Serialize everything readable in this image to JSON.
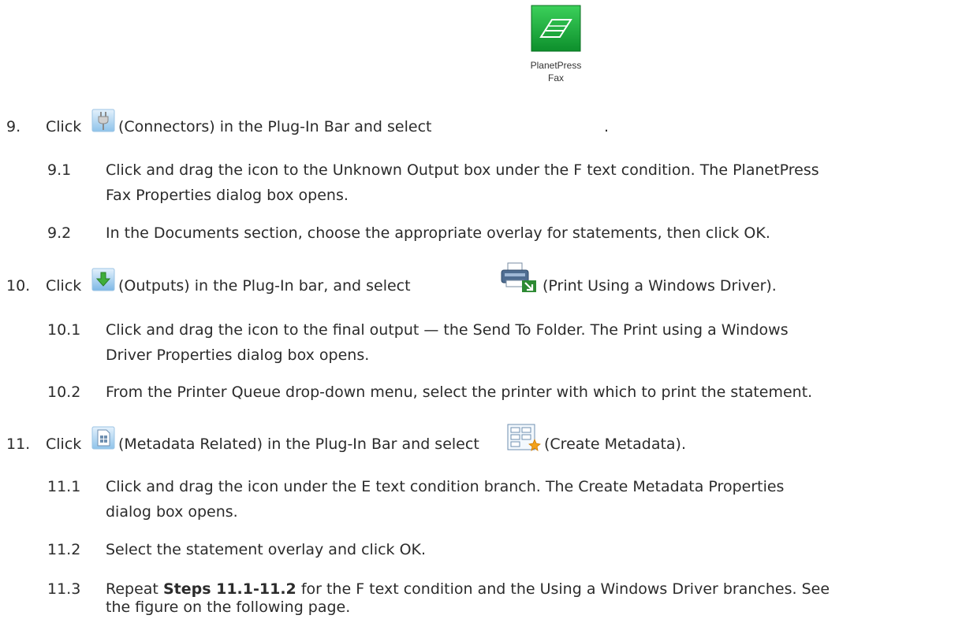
{
  "steps": [
    {
      "number": "9.",
      "text_before": "Click",
      "plugin_icon": "connectors-plug-icon",
      "plugin_label": "(Connectors) in the Plug-In Bar and select",
      "target_icon": "planetpress-fax-icon",
      "target_icon_caption": [
        "PlanetPress",
        "Fax"
      ],
      "target_label": ".",
      "substeps": [
        {
          "number": "9.1",
          "lines": [
            "Click and drag the icon to the Unknown Output box under the F text condition. The PlanetPress",
            "Fax Properties dialog box opens."
          ]
        },
        {
          "number": "9.2",
          "lines": [
            "In the Documents section, choose the appropriate overlay for statements, then click OK."
          ]
        }
      ]
    },
    {
      "number": "10.",
      "text_before": "Click",
      "plugin_icon": "outputs-arrow-icon",
      "plugin_label": "(Outputs) in the Plug-In bar, and select",
      "target_icon": "print-windows-driver-icon",
      "target_label": "(Print Using a Windows Driver).",
      "substeps": [
        {
          "number": "10.1",
          "lines": [
            "Click and drag the icon to the final output — the Send To Folder. The Print using a Windows",
            "Driver Properties dialog box opens."
          ]
        },
        {
          "number": "10.2",
          "lines": [
            "From the Printer Queue drop-down menu, select the printer with which to print the statement."
          ]
        }
      ]
    },
    {
      "number": "11.",
      "text_before": "Click",
      "plugin_icon": "metadata-related-icon",
      "plugin_label": "(Metadata Related) in the Plug-In Bar and select",
      "target_icon": "create-metadata-icon",
      "target_label": "(Create Metadata).",
      "substeps": [
        {
          "number": "11.1",
          "lines": [
            "Click and drag the icon under the E text condition branch. The Create Metadata Properties",
            "dialog box opens."
          ]
        },
        {
          "number": "11.2",
          "lines": [
            "Select the statement overlay and click OK."
          ]
        },
        {
          "number": "11.3",
          "text_before": "Repeat",
          "bold_text": "Steps 11.1-11.2",
          "text_after": "for the F text condition and the Using a Windows Driver branches. See",
          "line2": "the figure on the following page."
        }
      ]
    }
  ]
}
